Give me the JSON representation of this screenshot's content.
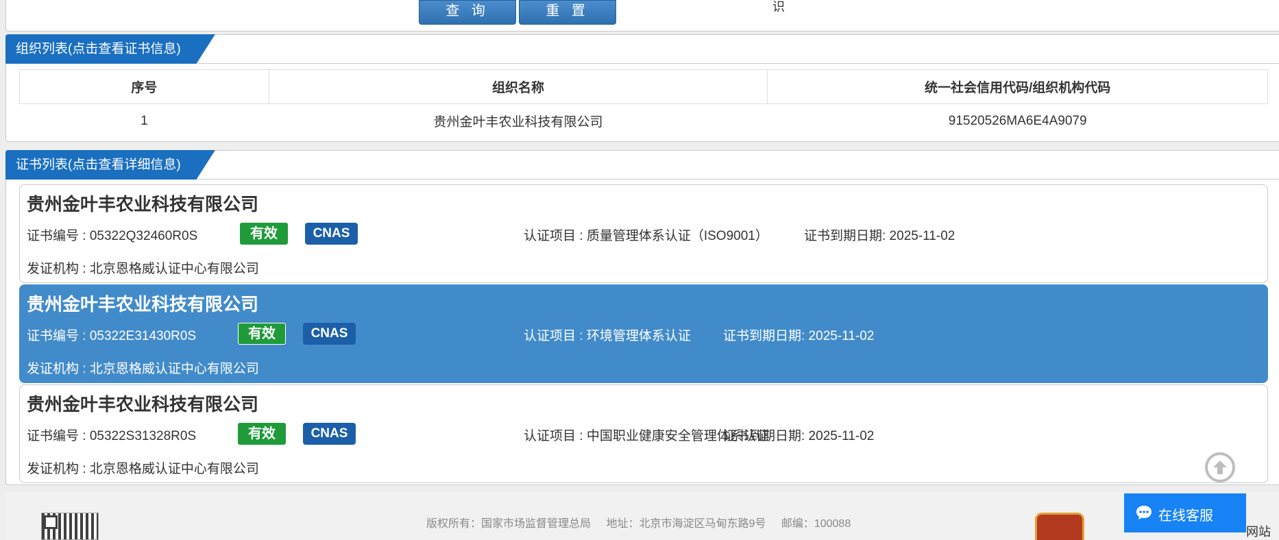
{
  "search": {
    "query_label": "查 询",
    "reset_label": "重 置",
    "stray_char": "识"
  },
  "org_section": {
    "title": "组织列表(点击查看证书信息)",
    "headers": [
      "序号",
      "组织名称",
      "统一社会信用代码/组织机构代码"
    ],
    "rows": [
      {
        "index": "1",
        "name": "贵州金叶丰农业科技有限公司",
        "code": "91520526MA6E4A9079"
      }
    ]
  },
  "cert_section": {
    "title": "证书列表(点击查看详细信息)",
    "certs": [
      {
        "company": "贵州金叶丰农业科技有限公司",
        "cert_no": "证书编号 : 05322Q32460R0S",
        "status": "有效",
        "accreditation": "CNAS",
        "project": "认证项目 : 质量管理体系认证（ISO9001）",
        "expiry": "证书到期日期: 2025-11-02",
        "issuer": "发证机构 : 北京恩格威认证中心有限公司",
        "selected": false
      },
      {
        "company": "贵州金叶丰农业科技有限公司",
        "cert_no": "证书编号 : 05322E31430R0S",
        "status": "有效",
        "accreditation": "CNAS",
        "project": "认证项目 : 环境管理体系认证",
        "expiry": "证书到期日期: 2025-11-02",
        "issuer": "发证机构 : 北京恩格威认证中心有限公司",
        "selected": true
      },
      {
        "company": "贵州金叶丰农业科技有限公司",
        "cert_no": "证书编号 : 05322S31328R0S",
        "status": "有效",
        "accreditation": "CNAS",
        "project": "认证项目 : 中国职业健康安全管理体系认证",
        "expiry": "证书到期日期: 2025-11-02",
        "issuer": "发证机构 : 北京恩格威认证中心有限公司",
        "selected": false
      }
    ]
  },
  "footer": {
    "copyright": "版权所有：国家市场监督管理总局",
    "address": "地址：北京市海淀区马甸东路9号",
    "postcode": "邮编：100088",
    "partial_text": "网站"
  },
  "chat": {
    "label": "在线客服"
  },
  "colors": {
    "primary": "#1a6fc0",
    "selected_card": "#428bca",
    "valid_badge": "#1f9b3a",
    "cnas_badge": "#1b5fa8",
    "chat_button": "#1783f5"
  },
  "icons": {
    "back_to_top": "arrow-up-circle-icon",
    "chat": "speech-bubble-icon",
    "qr": "qr-code-icon",
    "emblem": "emblem-icon"
  }
}
